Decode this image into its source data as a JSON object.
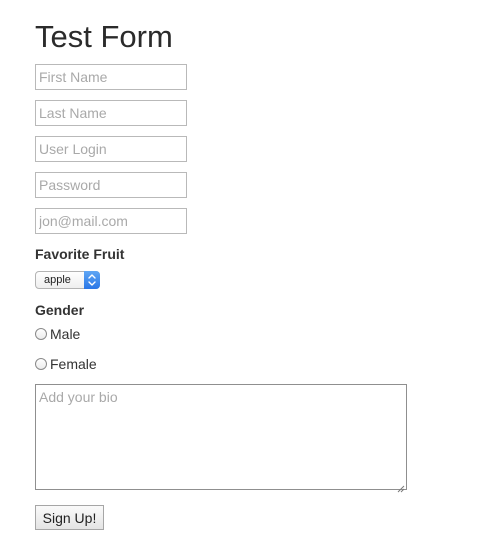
{
  "form": {
    "title": "Test Form",
    "first_name": {
      "placeholder": "First Name",
      "value": ""
    },
    "last_name": {
      "placeholder": "Last Name",
      "value": ""
    },
    "user_login": {
      "placeholder": "User Login",
      "value": ""
    },
    "password": {
      "placeholder": "Password",
      "value": ""
    },
    "email": {
      "placeholder": "jon@mail.com",
      "value": ""
    },
    "fruit": {
      "label": "Favorite Fruit",
      "selected": "apple"
    },
    "gender": {
      "label": "Gender",
      "options": [
        "Male",
        "Female"
      ]
    },
    "bio": {
      "placeholder": "Add your bio",
      "value": ""
    },
    "submit_label": "Sign Up!"
  },
  "colors": {
    "select_arrow_top": "#5fa6f4",
    "select_arrow_bottom": "#2a76e6",
    "input_border": "#b9b9b9",
    "placeholder": "#a9a9a9"
  },
  "icons": {
    "select_arrows": "up-down-chevron-icon",
    "resize_grip": "resize-grip-icon"
  }
}
